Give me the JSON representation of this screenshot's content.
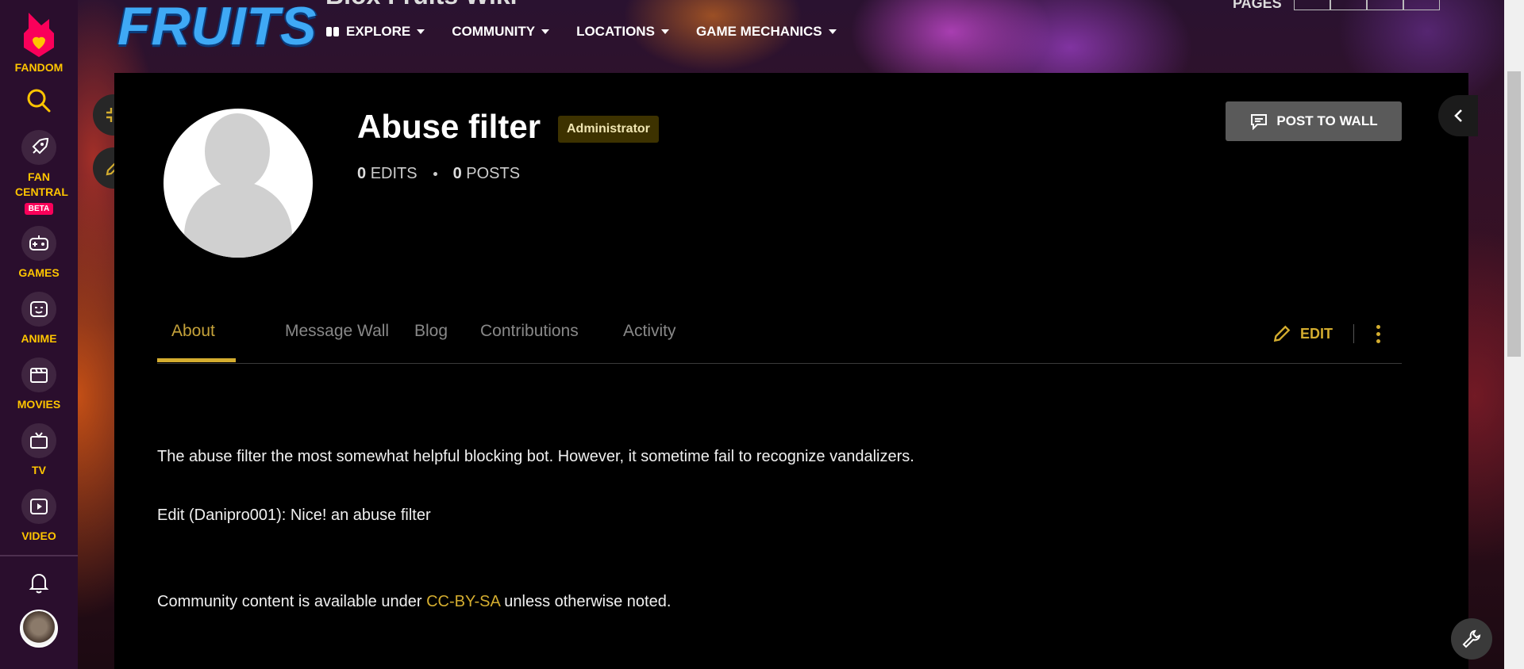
{
  "rail": {
    "brand": "FANDOM",
    "items": [
      {
        "label": "FAN CENTRAL",
        "badge": "BETA",
        "icon": "rocket-icon"
      },
      {
        "label": "GAMES",
        "icon": "controller-icon"
      },
      {
        "label": "ANIME",
        "icon": "anime-face-icon"
      },
      {
        "label": "MOVIES",
        "icon": "clapperboard-icon"
      },
      {
        "label": "TV",
        "icon": "tv-icon"
      },
      {
        "label": "VIDEO",
        "icon": "play-icon"
      }
    ]
  },
  "header": {
    "logo": "FRUITS",
    "wiki_title": "Blox Fruits Wiki",
    "nav": [
      {
        "label": "EXPLORE"
      },
      {
        "label": "COMMUNITY"
      },
      {
        "label": "LOCATIONS"
      },
      {
        "label": "GAME MECHANICS"
      }
    ],
    "pages_label": "PAGES"
  },
  "profile": {
    "username": "Abuse filter",
    "role_badge": "Administrator",
    "edits_count": "0",
    "edits_label": "EDITS",
    "posts_count": "0",
    "posts_label": "POSTS",
    "post_to_wall": "POST TO WALL"
  },
  "tabs": [
    {
      "label": "About",
      "active": true
    },
    {
      "label": "Message Wall"
    },
    {
      "label": "Blog"
    },
    {
      "label": "Contributions"
    },
    {
      "label": "Activity"
    }
  ],
  "about": {
    "edit_label": "EDIT",
    "paragraph1": "The abuse filter the most somewhat helpful blocking bot. However, it sometime fail to recognize vandalizers.",
    "paragraph2": "Edit (Danipro001): Nice! an abuse filter",
    "license_prefix": "Community content is available under ",
    "license_link": "CC-BY-SA",
    "license_suffix": " unless otherwise noted."
  },
  "colors": {
    "accent": "#d4ad2f",
    "rail_bg": "#2a0e2d",
    "fandom_pink": "#fa005a"
  }
}
